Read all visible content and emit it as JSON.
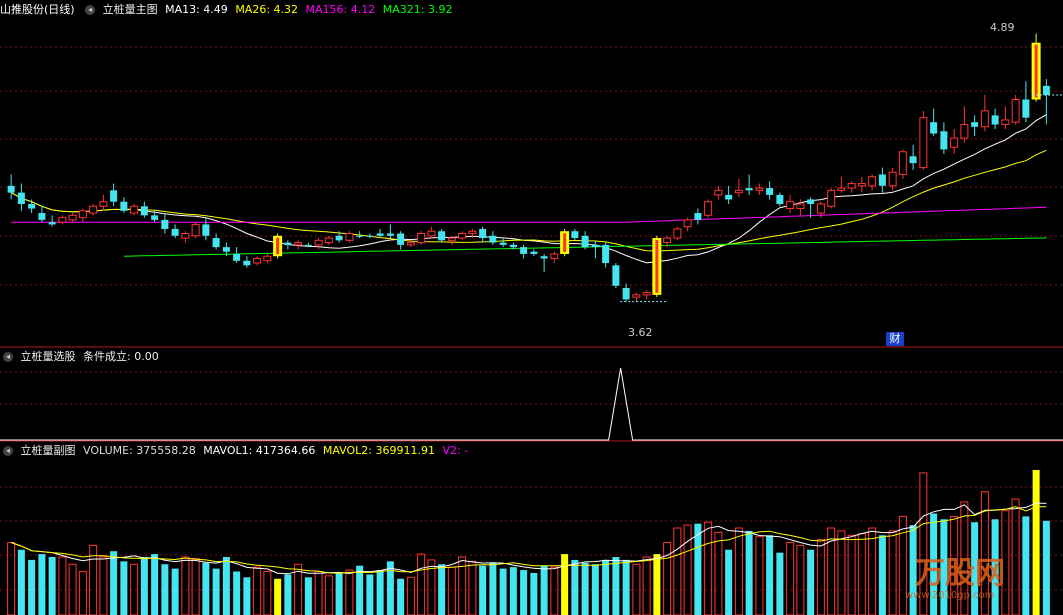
{
  "main_panel": {
    "stock_name": "山推股份(日线)",
    "indicator_name": "立桩量主图",
    "ma_labels": [
      {
        "text": "MA13: 4.49",
        "color": "#ffffff"
      },
      {
        "text": "MA26: 4.32",
        "color": "#ffff00"
      },
      {
        "text": "MA156: 4.12",
        "color": "#ff00ff"
      },
      {
        "text": "MA321: 3.92",
        "color": "#00ff00"
      }
    ],
    "high_label": "4.89",
    "low_label": "3.62",
    "finance_badge": "财"
  },
  "select_panel": {
    "indicator_name": "立桩量选股",
    "condition_label": "条件成立: 0.00"
  },
  "volume_panel": {
    "indicator_name": "立桩量副图",
    "labels": [
      {
        "text": "VOLUME: 375558.28",
        "color": "#dddddd"
      },
      {
        "text": "MAVOL1: 417364.66",
        "color": "#ffffff"
      },
      {
        "text": "MAVOL2: 369911.91",
        "color": "#ffff00"
      },
      {
        "text": "V2: -",
        "color": "#ff00ff"
      }
    ]
  },
  "watermark": "万股网",
  "watermark_url": "www.2010gp.com",
  "colors": {
    "up": "#ff3333",
    "down": "#44e5f0",
    "highlight": "#ffff00",
    "ma13": "#ffffff",
    "ma26": "#ffff00",
    "ma156": "#ff00ff",
    "ma321": "#00ff00",
    "grid": "#7a1010"
  },
  "chart_data": {
    "type": "candlestick",
    "price_ylim": [
      3.55,
      4.95
    ],
    "candles": [
      [
        4.22,
        4.27,
        4.16,
        4.19,
        "d"
      ],
      [
        4.19,
        4.23,
        4.11,
        4.14,
        "d"
      ],
      [
        4.14,
        4.16,
        4.1,
        4.12,
        "d"
      ],
      [
        4.1,
        4.13,
        4.06,
        4.07,
        "d"
      ],
      [
        4.06,
        4.09,
        4.04,
        4.05,
        "d"
      ],
      [
        4.06,
        4.09,
        4.05,
        4.08,
        "u"
      ],
      [
        4.07,
        4.1,
        4.06,
        4.09,
        "u"
      ],
      [
        4.08,
        4.12,
        4.06,
        4.11,
        "u"
      ],
      [
        4.1,
        4.14,
        4.09,
        4.13,
        "u"
      ],
      [
        4.13,
        4.18,
        4.11,
        4.15,
        "u"
      ],
      [
        4.2,
        4.23,
        4.13,
        4.15,
        "d"
      ],
      [
        4.15,
        4.17,
        4.1,
        4.11,
        "d"
      ],
      [
        4.1,
        4.14,
        4.09,
        4.13,
        "u"
      ],
      [
        4.13,
        4.15,
        4.08,
        4.09,
        "d"
      ],
      [
        4.09,
        4.11,
        4.06,
        4.07,
        "d"
      ],
      [
        4.07,
        4.1,
        4.01,
        4.03,
        "d"
      ],
      [
        4.03,
        4.05,
        3.99,
        4.0,
        "d"
      ],
      [
        3.99,
        4.02,
        3.97,
        4.01,
        "u"
      ],
      [
        4.0,
        4.06,
        3.99,
        4.05,
        "u"
      ],
      [
        4.05,
        4.08,
        3.98,
        4.0,
        "d"
      ],
      [
        3.99,
        4.01,
        3.94,
        3.95,
        "d"
      ],
      [
        3.95,
        3.97,
        3.91,
        3.93,
        "d"
      ],
      [
        3.92,
        3.95,
        3.88,
        3.89,
        "d"
      ],
      [
        3.89,
        3.91,
        3.86,
        3.87,
        "d"
      ],
      [
        3.88,
        3.91,
        3.87,
        3.9,
        "u"
      ],
      [
        3.89,
        3.92,
        3.88,
        3.91,
        "u"
      ],
      [
        3.91,
        4.01,
        3.9,
        4.0,
        "h"
      ],
      [
        3.97,
        3.98,
        3.94,
        3.96,
        "d"
      ],
      [
        3.96,
        3.98,
        3.94,
        3.97,
        "u"
      ],
      [
        3.96,
        3.97,
        3.95,
        3.96,
        "d"
      ],
      [
        3.96,
        3.99,
        3.94,
        3.98,
        "u"
      ],
      [
        3.97,
        4.0,
        3.96,
        3.99,
        "u"
      ],
      [
        4.0,
        4.02,
        3.97,
        3.98,
        "d"
      ],
      [
        3.98,
        4.02,
        3.97,
        4.01,
        "u"
      ],
      [
        4.0,
        4.02,
        3.99,
        4.0,
        "d"
      ],
      [
        4.0,
        4.01,
        3.99,
        4.0,
        "d"
      ],
      [
        4.01,
        4.03,
        3.99,
        4.0,
        "d"
      ],
      [
        4.01,
        4.05,
        3.99,
        4.0,
        "d"
      ],
      [
        4.01,
        4.02,
        3.94,
        3.96,
        "d"
      ],
      [
        3.96,
        3.98,
        3.95,
        3.97,
        "u"
      ],
      [
        3.97,
        4.02,
        3.96,
        4.01,
        "u"
      ],
      [
        4.0,
        4.04,
        3.99,
        4.02,
        "u"
      ],
      [
        4.02,
        4.03,
        3.97,
        3.98,
        "d"
      ],
      [
        3.98,
        4.0,
        3.96,
        3.99,
        "u"
      ],
      [
        3.99,
        4.02,
        3.98,
        4.01,
        "u"
      ],
      [
        4.01,
        4.03,
        3.99,
        4.02,
        "u"
      ],
      [
        4.03,
        4.04,
        3.97,
        3.99,
        "d"
      ],
      [
        4.0,
        4.02,
        3.96,
        3.97,
        "d"
      ],
      [
        3.97,
        3.99,
        3.95,
        3.96,
        "d"
      ],
      [
        3.96,
        3.97,
        3.94,
        3.95,
        "d"
      ],
      [
        3.95,
        3.96,
        3.9,
        3.92,
        "d"
      ],
      [
        3.93,
        3.94,
        3.91,
        3.92,
        "d"
      ],
      [
        3.91,
        3.92,
        3.84,
        3.9,
        "d"
      ],
      [
        3.9,
        3.93,
        3.88,
        3.92,
        "u"
      ],
      [
        3.92,
        4.03,
        3.91,
        4.02,
        "h"
      ],
      [
        4.02,
        4.03,
        3.98,
        3.99,
        "d"
      ],
      [
        4.0,
        4.02,
        3.94,
        3.95,
        "d"
      ],
      [
        3.95,
        3.98,
        3.9,
        3.96,
        "d"
      ],
      [
        3.96,
        3.97,
        3.86,
        3.88,
        "d"
      ],
      [
        3.87,
        3.88,
        3.77,
        3.78,
        "d"
      ],
      [
        3.77,
        3.79,
        3.71,
        3.72,
        "d"
      ],
      [
        3.73,
        3.75,
        3.71,
        3.74,
        "u"
      ],
      [
        3.74,
        3.76,
        3.72,
        3.75,
        "u"
      ],
      [
        3.74,
        4.0,
        3.73,
        3.99,
        "h"
      ],
      [
        3.97,
        4.0,
        3.95,
        3.99,
        "u"
      ],
      [
        3.99,
        4.04,
        3.98,
        4.03,
        "u"
      ],
      [
        4.04,
        4.08,
        4.02,
        4.07,
        "u"
      ],
      [
        4.1,
        4.12,
        4.05,
        4.07,
        "d"
      ],
      [
        4.09,
        4.16,
        4.08,
        4.15,
        "u"
      ],
      [
        4.18,
        4.22,
        4.16,
        4.2,
        "u"
      ],
      [
        4.16,
        4.22,
        4.14,
        4.18,
        "d"
      ],
      [
        4.19,
        4.25,
        4.17,
        4.2,
        "u"
      ],
      [
        4.21,
        4.27,
        4.18,
        4.2,
        "d"
      ],
      [
        4.2,
        4.23,
        4.18,
        4.21,
        "u"
      ],
      [
        4.21,
        4.24,
        4.16,
        4.18,
        "d"
      ],
      [
        4.18,
        4.19,
        4.13,
        4.14,
        "d"
      ],
      [
        4.15,
        4.18,
        4.1,
        4.12,
        "u"
      ],
      [
        4.12,
        4.16,
        4.09,
        4.14,
        "u"
      ],
      [
        4.16,
        4.17,
        4.08,
        4.14,
        "d"
      ],
      [
        4.1,
        4.15,
        4.08,
        4.14,
        "u"
      ],
      [
        4.13,
        4.21,
        4.12,
        4.2,
        "u"
      ],
      [
        4.2,
        4.26,
        4.19,
        4.21,
        "u"
      ],
      [
        4.21,
        4.24,
        4.19,
        4.23,
        "u"
      ],
      [
        4.22,
        4.26,
        4.19,
        4.23,
        "u"
      ],
      [
        4.22,
        4.27,
        4.2,
        4.26,
        "u"
      ],
      [
        4.27,
        4.3,
        4.19,
        4.22,
        "d"
      ],
      [
        4.22,
        4.3,
        4.2,
        4.28,
        "u"
      ],
      [
        4.27,
        4.38,
        4.25,
        4.37,
        "u"
      ],
      [
        4.35,
        4.4,
        4.29,
        4.32,
        "d"
      ],
      [
        4.3,
        4.55,
        4.29,
        4.52,
        "u"
      ],
      [
        4.5,
        4.56,
        4.44,
        4.45,
        "d"
      ],
      [
        4.46,
        4.5,
        4.36,
        4.38,
        "d"
      ],
      [
        4.39,
        4.47,
        4.36,
        4.43,
        "u"
      ],
      [
        4.43,
        4.57,
        4.41,
        4.49,
        "u"
      ],
      [
        4.5,
        4.53,
        4.44,
        4.48,
        "d"
      ],
      [
        4.48,
        4.62,
        4.46,
        4.55,
        "u"
      ],
      [
        4.53,
        4.56,
        4.47,
        4.49,
        "d"
      ],
      [
        4.49,
        4.57,
        4.47,
        4.51,
        "u"
      ],
      [
        4.5,
        4.62,
        4.49,
        4.6,
        "u"
      ],
      [
        4.6,
        4.68,
        4.5,
        4.52,
        "d"
      ],
      [
        4.6,
        4.89,
        4.59,
        4.85,
        "h"
      ],
      [
        4.62,
        4.69,
        4.49,
        4.66,
        "d"
      ]
    ],
    "volume": [
      [
        0.5,
        "u"
      ],
      [
        0.45,
        "d"
      ],
      [
        0.38,
        "d"
      ],
      [
        0.42,
        "d"
      ],
      [
        0.4,
        "d"
      ],
      [
        0.4,
        "u"
      ],
      [
        0.35,
        "u"
      ],
      [
        0.3,
        "u"
      ],
      [
        0.48,
        "u"
      ],
      [
        0.4,
        "u"
      ],
      [
        0.44,
        "d"
      ],
      [
        0.37,
        "d"
      ],
      [
        0.35,
        "u"
      ],
      [
        0.4,
        "d"
      ],
      [
        0.42,
        "d"
      ],
      [
        0.35,
        "d"
      ],
      [
        0.32,
        "d"
      ],
      [
        0.4,
        "u"
      ],
      [
        0.39,
        "u"
      ],
      [
        0.36,
        "d"
      ],
      [
        0.32,
        "d"
      ],
      [
        0.4,
        "d"
      ],
      [
        0.3,
        "d"
      ],
      [
        0.26,
        "d"
      ],
      [
        0.33,
        "u"
      ],
      [
        0.3,
        "u"
      ],
      [
        0.25,
        "h"
      ],
      [
        0.28,
        "d"
      ],
      [
        0.35,
        "u"
      ],
      [
        0.26,
        "d"
      ],
      [
        0.3,
        "u"
      ],
      [
        0.27,
        "u"
      ],
      [
        0.29,
        "d"
      ],
      [
        0.31,
        "u"
      ],
      [
        0.34,
        "d"
      ],
      [
        0.28,
        "d"
      ],
      [
        0.31,
        "d"
      ],
      [
        0.37,
        "d"
      ],
      [
        0.25,
        "d"
      ],
      [
        0.26,
        "u"
      ],
      [
        0.42,
        "u"
      ],
      [
        0.38,
        "u"
      ],
      [
        0.35,
        "d"
      ],
      [
        0.33,
        "u"
      ],
      [
        0.4,
        "u"
      ],
      [
        0.37,
        "u"
      ],
      [
        0.34,
        "d"
      ],
      [
        0.36,
        "d"
      ],
      [
        0.32,
        "d"
      ],
      [
        0.33,
        "d"
      ],
      [
        0.31,
        "d"
      ],
      [
        0.29,
        "d"
      ],
      [
        0.34,
        "d"
      ],
      [
        0.33,
        "u"
      ],
      [
        0.42,
        "h"
      ],
      [
        0.38,
        "d"
      ],
      [
        0.36,
        "d"
      ],
      [
        0.35,
        "d"
      ],
      [
        0.38,
        "d"
      ],
      [
        0.4,
        "d"
      ],
      [
        0.38,
        "d"
      ],
      [
        0.35,
        "u"
      ],
      [
        0.4,
        "u"
      ],
      [
        0.42,
        "h"
      ],
      [
        0.5,
        "u"
      ],
      [
        0.6,
        "u"
      ],
      [
        0.62,
        "u"
      ],
      [
        0.63,
        "d"
      ],
      [
        0.64,
        "u"
      ],
      [
        0.57,
        "u"
      ],
      [
        0.45,
        "d"
      ],
      [
        0.6,
        "u"
      ],
      [
        0.58,
        "d"
      ],
      [
        0.54,
        "u"
      ],
      [
        0.55,
        "d"
      ],
      [
        0.43,
        "d"
      ],
      [
        0.5,
        "u"
      ],
      [
        0.48,
        "u"
      ],
      [
        0.45,
        "d"
      ],
      [
        0.52,
        "u"
      ],
      [
        0.6,
        "u"
      ],
      [
        0.58,
        "u"
      ],
      [
        0.55,
        "u"
      ],
      [
        0.56,
        "u"
      ],
      [
        0.6,
        "u"
      ],
      [
        0.55,
        "d"
      ],
      [
        0.58,
        "u"
      ],
      [
        0.68,
        "u"
      ],
      [
        0.62,
        "d"
      ],
      [
        0.98,
        "u"
      ],
      [
        0.7,
        "d"
      ],
      [
        0.66,
        "d"
      ],
      [
        0.68,
        "u"
      ],
      [
        0.78,
        "u"
      ],
      [
        0.64,
        "d"
      ],
      [
        0.85,
        "u"
      ],
      [
        0.66,
        "d"
      ],
      [
        0.72,
        "u"
      ],
      [
        0.8,
        "u"
      ],
      [
        0.68,
        "d"
      ],
      [
        1.0,
        "h"
      ],
      [
        0.65,
        "d"
      ]
    ],
    "selection_signal_index": 54,
    "price_labels": [
      "4.89",
      "3.62"
    ]
  }
}
